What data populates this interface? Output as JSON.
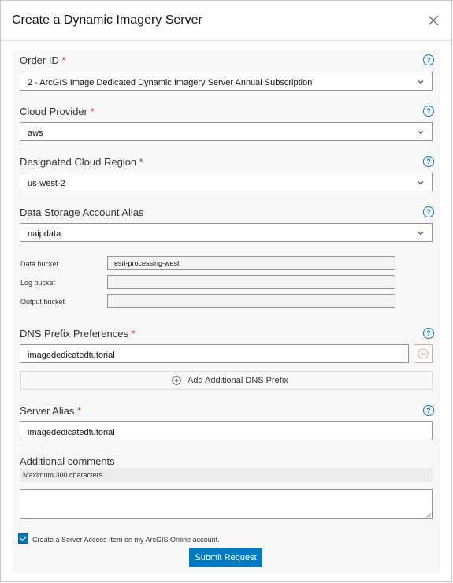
{
  "dialog": {
    "title": "Create a Dynamic Imagery Server"
  },
  "form": {
    "order_id": {
      "label": "Order ID",
      "required_mark": "*",
      "value": "2 - ArcGIS Image Dedicated Dynamic Imagery Server Annual Subscription"
    },
    "cloud_provider": {
      "label": "Cloud Provider",
      "required_mark": "*",
      "value": "aws"
    },
    "cloud_region": {
      "label": "Designated Cloud Region",
      "required_mark": "*",
      "value": "us-west-2"
    },
    "storage_alias": {
      "label": "Data Storage Account Alias",
      "value": "naipdata"
    },
    "buckets": {
      "data_label": "Data bucket",
      "data_value": "esri-processing-west",
      "log_label": "Log bucket",
      "log_value": "",
      "output_label": "Output bucket",
      "output_value": ""
    },
    "dns": {
      "label": "DNS Prefix Preferences",
      "required_mark": "*",
      "value": "imagededicatedtutorial",
      "add_label": "Add Additional DNS Prefix"
    },
    "server_alias": {
      "label": "Server Alias",
      "required_mark": "*",
      "value": "imagededicatedtutorial"
    },
    "comments": {
      "label": "Additional comments",
      "hint": "Maximum 300 characters.",
      "value": ""
    },
    "access_item": {
      "label": "Create a Server Access Item on my ArcGIS Online account.",
      "checked": true
    },
    "help_glyph": "?",
    "submit_label": "Submit Request"
  },
  "icons": {
    "close": "close-icon",
    "help": "help-circle-icon",
    "chevron": "chevron-down-icon",
    "remove": "minus-circle-icon",
    "add": "plus-circle-icon",
    "check": "checkmark-icon"
  },
  "colors": {
    "accent": "#007ac2",
    "required": "#d83020",
    "remove": "#e4a49b"
  }
}
